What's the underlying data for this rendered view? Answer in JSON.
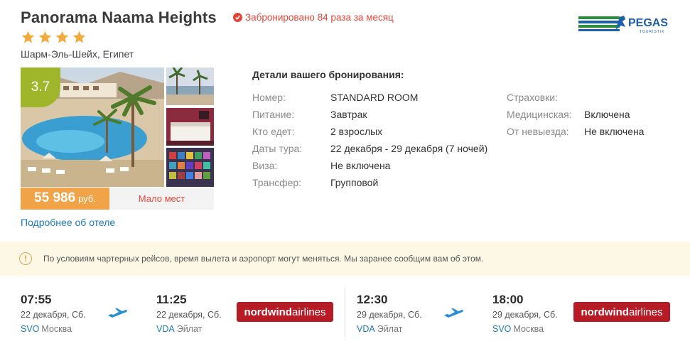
{
  "hotel": {
    "name": "Panorama Naama Heights",
    "booked_text": "Забронировано 84 раза за месяц",
    "stars": 4,
    "location": "Шарм-Эль-Шейх, Египет",
    "rating": "3.7",
    "price_amount": "55 986",
    "price_currency": "руб.",
    "availability": "Мало мест",
    "more_link": "Подробнее об отеле"
  },
  "operator": {
    "logo_text": "PEGAS",
    "logo_sub": "TOURISTIK"
  },
  "details": {
    "title": "Детали вашего бронирования:",
    "left": [
      {
        "label": "Номер:",
        "value": "STANDARD ROOM"
      },
      {
        "label": "Питание:",
        "value": "Завтрак"
      },
      {
        "label": "Кто едет:",
        "value": "2 взрослых"
      },
      {
        "label": "Даты тура:",
        "value": "22 декабря - 29 декабря (7 ночей)"
      },
      {
        "label": "Виза:",
        "value": "Не включена"
      },
      {
        "label": "Трансфер:",
        "value": "Групповой"
      }
    ],
    "right": [
      {
        "label": "Страховки:",
        "value": ""
      },
      {
        "label": "Медицинская:",
        "value": "Включена"
      },
      {
        "label": "От невыезда:",
        "value": "Не включена"
      }
    ]
  },
  "notice": "По условиям чартерных рейсов, время вылета и аэропорт могут меняться. Мы заранее сообщим вам об этом.",
  "flights": [
    {
      "dep_time": "07:55",
      "dep_date": "22 декабря, Сб.",
      "dep_code": "SVO",
      "dep_city": "Москва",
      "arr_time": "11:25",
      "arr_date": "22 декабря, Сб.",
      "arr_code": "VDA",
      "arr_city": "Эйлат",
      "airline_bold": "nordwind",
      "airline_rest": "airlines"
    },
    {
      "dep_time": "12:30",
      "dep_date": "29 декабря, Сб.",
      "dep_code": "VDA",
      "dep_city": "Эйлат",
      "arr_time": "18:00",
      "arr_date": "29 декабря, Сб.",
      "arr_code": "SVO",
      "arr_city": "Москва",
      "airline_bold": "nordwind",
      "airline_rest": "airlines"
    }
  ],
  "colors": {
    "accent_red": "#e4453a",
    "rating_green": "#9fb52a",
    "price_orange": "#f0a347",
    "link_blue": "#1d7ab8",
    "airline_red": "#b71c26"
  }
}
